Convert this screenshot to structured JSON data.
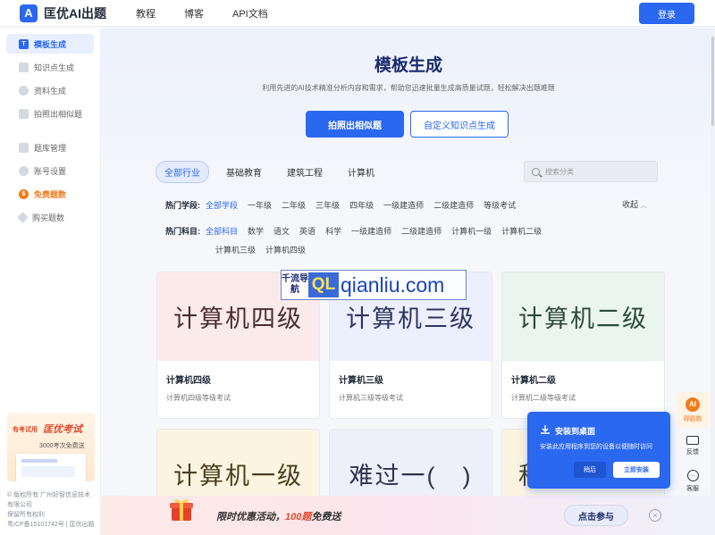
{
  "header": {
    "brand": "匡优AI出题",
    "logo_letter": "A",
    "nav": [
      "教程",
      "博客",
      "API文档"
    ],
    "login_label": "登录"
  },
  "sidebar": {
    "items": [
      {
        "label": "模板生成",
        "icon": "template-icon",
        "active": true
      },
      {
        "label": "知识点生成",
        "icon": "knowledge-icon"
      },
      {
        "label": "资料生成",
        "icon": "document-icon"
      },
      {
        "label": "拍照出相似题",
        "icon": "camera-icon"
      },
      {
        "label": "题库管理",
        "icon": "bank-icon"
      },
      {
        "label": "账号设置",
        "icon": "user-icon"
      },
      {
        "label": "免费题数",
        "icon": "coin-icon",
        "promo": true
      },
      {
        "label": "购买题数",
        "icon": "diamond-icon"
      }
    ],
    "banner": {
      "tag": "有考试用",
      "brand": "匡优考试",
      "sub": "3000考次免费送"
    },
    "footer": [
      "© 版权所有 广州好智信息技术有限公司",
      "保留所有权利",
      "粤ICP备15101742号 | 匡优出题"
    ]
  },
  "hero": {
    "title": "模板生成",
    "subtitle": "利用先进的AI技术精准分析内容和需求，帮助您迅速批量生成高质量试题，轻松解决出题难题",
    "primary_btn": "拍照出相似题",
    "secondary_btn": "自定义知识点生成"
  },
  "tabs": [
    "全部行业",
    "基础教育",
    "建筑工程",
    "计算机"
  ],
  "search": {
    "placeholder": "搜索分类"
  },
  "filters": {
    "stage_label": "热门学段:",
    "stages": [
      "全部学段",
      "一年级",
      "二年级",
      "三年级",
      "四年级",
      "一级建造师",
      "二级建造师",
      "等级考试"
    ],
    "collapse_label": "收起",
    "subject_label": "热门科目:",
    "subjects_line1": [
      "全部科目",
      "数学",
      "语文",
      "英语",
      "科学",
      "一级建造师",
      "二级建造师",
      "计算机一级",
      "计算机二级"
    ],
    "subjects_line2": [
      "计算机三级",
      "计算机四级"
    ]
  },
  "cards": [
    {
      "image_text": "计算机四级",
      "title": "计算机四级",
      "desc": "计算机四级等级考试",
      "bg": "#fbeaea",
      "color": "#4a2e2e"
    },
    {
      "image_text": "计算机三级",
      "title": "计算机三级",
      "desc": "计算机三级等级考试",
      "bg": "#eceffc",
      "color": "#2e3561"
    },
    {
      "image_text": "计算机二级",
      "title": "计算机二级",
      "desc": "计算机二级等级考试",
      "bg": "#e9f5ee",
      "color": "#2e4a3b"
    },
    {
      "image_text": "计算机一级",
      "bg": "#fbf4e1",
      "color": "#4a3e20"
    },
    {
      "image_text": "难过一(　)",
      "bg": "#edf0f8",
      "color": "#2e3350"
    },
    {
      "image_text": "秋",
      "bg": "#fbf4e1",
      "color": "#4a3e20"
    }
  ],
  "watermark": {
    "left_text": "千流导航",
    "box": "QL",
    "right": "qianliu.com"
  },
  "promo_bar": {
    "text_a": "限时优惠活动，",
    "text_hi": "100题",
    "text_b": "免费送",
    "button": "点击参与",
    "close": "×"
  },
  "install_popup": {
    "title": "安装到桌面",
    "desc": "安装此应用程序到您的设备以便随时访问",
    "later": "稍后",
    "ok": "立即安装"
  },
  "float_bar": [
    {
      "label": "得题数",
      "icon": "AI"
    },
    {
      "label": "反馈",
      "icon": ""
    },
    {
      "label": "客服",
      "icon": "···"
    }
  ]
}
